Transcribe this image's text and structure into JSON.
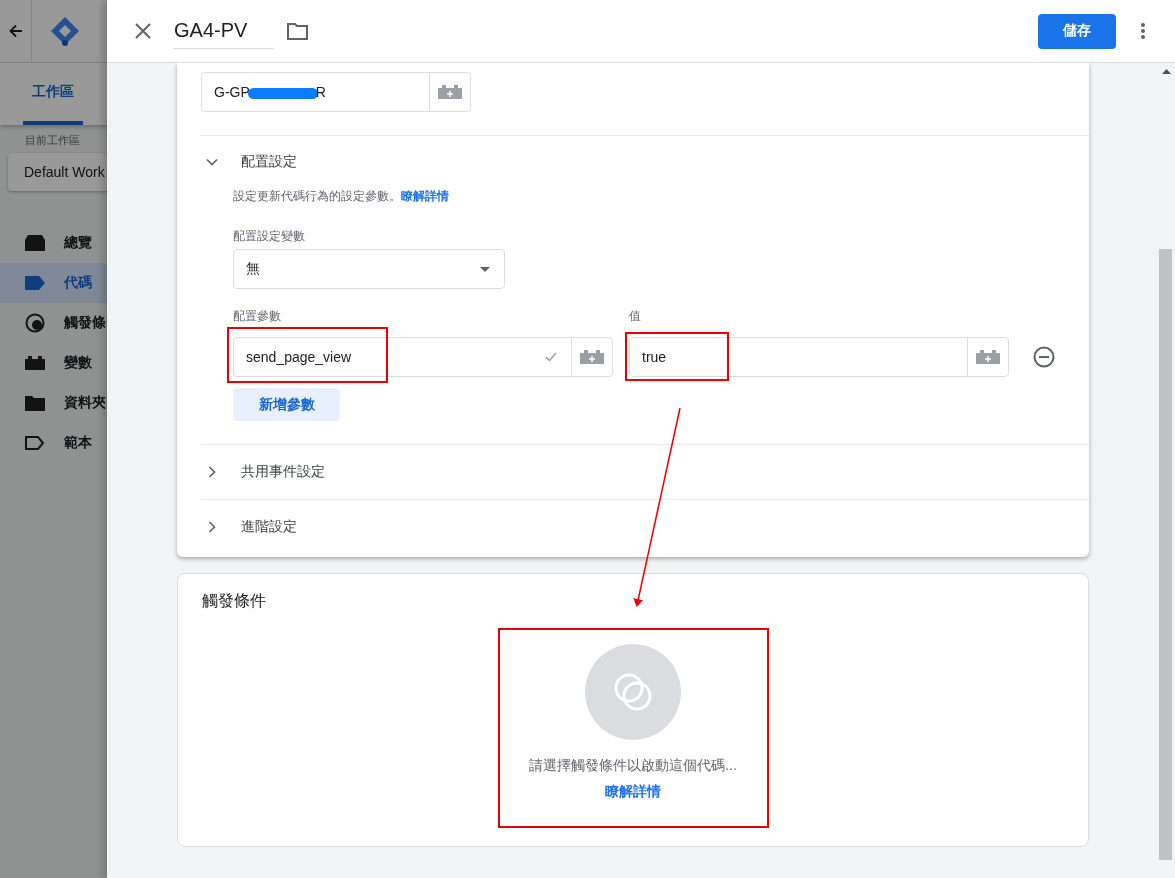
{
  "background_app": {
    "tab": {
      "label": "工作區",
      "selected": true
    },
    "workspace_label": "目前工作區",
    "workspace": "Default Work",
    "nav": [
      {
        "label": "總覽",
        "selected": false
      },
      {
        "label": "代碼",
        "selected": true
      },
      {
        "label": "觸發條",
        "selected": false
      },
      {
        "label": "變數",
        "selected": false
      },
      {
        "label": "資料夾",
        "selected": false
      },
      {
        "label": "範本",
        "selected": false
      }
    ]
  },
  "header": {
    "title": "GA4-PV",
    "save_button": "儲存"
  },
  "tag_config": {
    "measurement_id": {
      "value_start": "G-GP",
      "value_end": "R"
    },
    "sections": [
      {
        "title": "配置設定",
        "expanded": true,
        "content": {
          "description": "設定更新代碼行為的設定參數。",
          "link": "瞭解詳情",
          "variable_label": "配置設定變數",
          "variable_value": "無",
          "param_label": "配置參數",
          "value_label": "值",
          "parameters": [
            {
              "name": "send_page_view",
              "value": "true",
              "valid": true
            }
          ],
          "add_button": "新增參數"
        }
      },
      {
        "title": "共用事件設定",
        "expanded": false
      },
      {
        "title": "進階設定",
        "expanded": false
      }
    ]
  },
  "triggering": {
    "title": "觸發條件",
    "message": "請選擇觸發條件以啟動這個代碼...",
    "link": "瞭解詳情"
  }
}
